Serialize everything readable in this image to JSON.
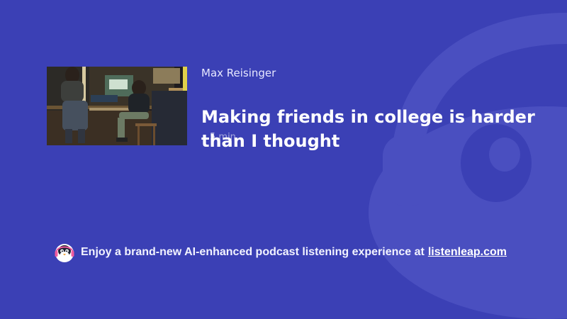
{
  "episode": {
    "author": "Max Reisinger",
    "title": "Making friends in college is harder than I thought",
    "duration": "5 min",
    "cover_icon": "podcast-cover-image"
  },
  "promo": {
    "text": "Enjoy a brand-new AI-enhanced podcast listening experience at",
    "link_text": "listenleap.com",
    "logo_icon": "penguin-headphones-logo-icon"
  },
  "colors": {
    "background": "#3b40b5",
    "watermark": "#4a4fbd",
    "text": "#ffffff"
  }
}
